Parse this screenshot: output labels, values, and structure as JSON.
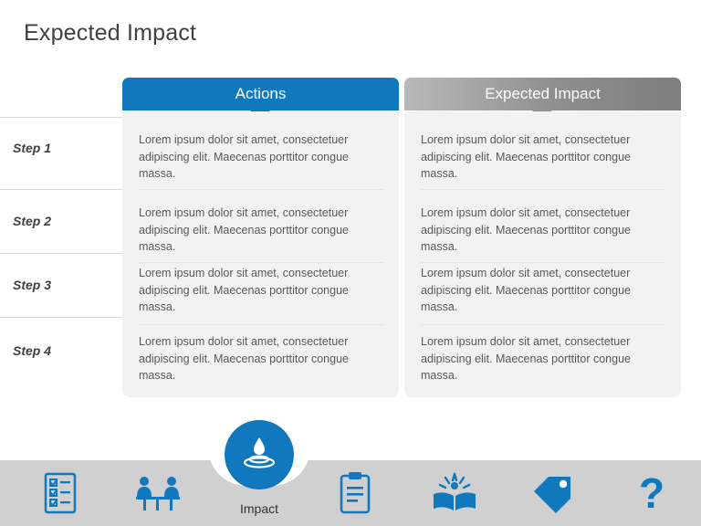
{
  "slide": {
    "title": "Expected Impact"
  },
  "columns": [
    {
      "id": "actions",
      "header": "Actions"
    },
    {
      "id": "impact",
      "header": "Expected Impact"
    }
  ],
  "steps": [
    {
      "label": "Step 1"
    },
    {
      "label": "Step 2"
    },
    {
      "label": "Step 3"
    },
    {
      "label": "Step 4"
    }
  ],
  "body_text": "Lorem ipsum dolor sit amet, consectetuer adipiscing elit. Maecenas porttitor congue massa.",
  "cells": {
    "actions": [
      "Lorem ipsum dolor sit amet, consectetuer adipiscing elit. Maecenas porttitor congue massa.",
      "Lorem ipsum dolor sit amet, consectetuer adipiscing elit. Maecenas porttitor congue massa.",
      "Lorem ipsum dolor sit amet, consectetuer adipiscing elit. Maecenas porttitor congue massa.",
      "Lorem ipsum dolor sit amet, consectetuer adipiscing elit. Maecenas porttitor congue massa."
    ],
    "impact": [
      "Lorem ipsum dolor sit amet, consectetuer adipiscing elit. Maecenas porttitor congue massa.",
      "Lorem ipsum dolor sit amet, consectetuer adipiscing elit. Maecenas porttitor congue massa.",
      "Lorem ipsum dolor sit amet, consectetuer adipiscing elit. Maecenas porttitor congue massa.",
      "Lorem ipsum dolor sit amet, consectetuer adipiscing elit. Maecenas porttitor congue massa."
    ]
  },
  "bottom_nav": {
    "active_label": "Impact",
    "active_icon": "impact-ripple-icon",
    "items": [
      {
        "icon": "checklist-icon"
      },
      {
        "icon": "meeting-table-icon"
      },
      {
        "icon": "clipboard-icon"
      },
      {
        "icon": "open-book-idea-icon"
      },
      {
        "icon": "price-tag-icon"
      },
      {
        "icon": "question-mark-icon"
      }
    ]
  },
  "colors": {
    "accent": "#1278be",
    "panel": "#f2f2f2",
    "bar": "#d0d0d0",
    "title": "#404040",
    "body": "#595959"
  }
}
